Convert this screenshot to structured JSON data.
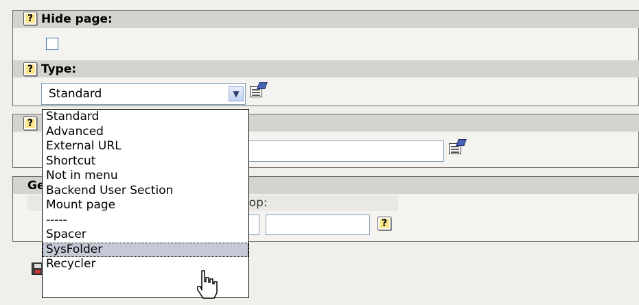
{
  "hide_page": {
    "label": "Hide page:",
    "checked": false
  },
  "type_field": {
    "label": "Type:",
    "selected": "Standard",
    "options": [
      "Standard",
      "Advanced",
      "External URL",
      "Shortcut",
      "Not in menu",
      "Backend User Section",
      "Mount page",
      "-----",
      "Spacer",
      "SysFolder",
      "Recycler"
    ],
    "highlighted_option": "SysFolder"
  },
  "general_section": {
    "header_partial": "Ge",
    "row_partial": "top:"
  },
  "icons": {
    "help": "help-icon",
    "wizard": "edit-wizard-icon",
    "save": "save-icon",
    "cursor": "hand-pointer-cursor",
    "dropdown_arrow": "chevron-down-icon"
  },
  "help_glyph": "?",
  "arrow_glyph": "▼"
}
